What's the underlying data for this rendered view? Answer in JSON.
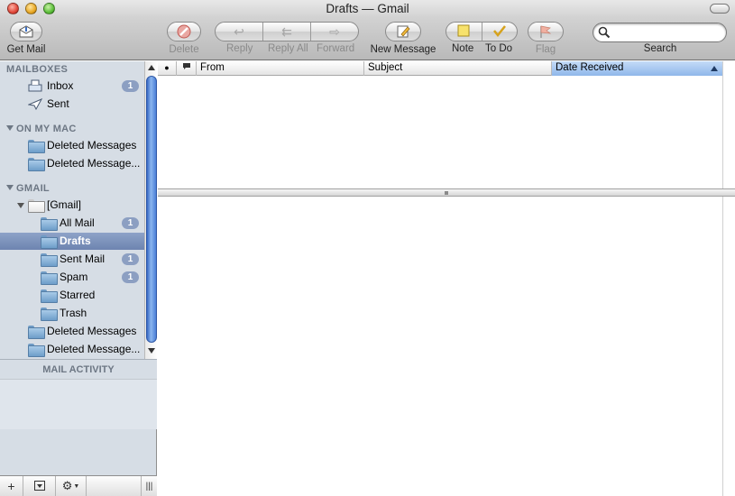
{
  "window": {
    "title": "Drafts — Gmail"
  },
  "toolbar": {
    "get_mail": "Get Mail",
    "delete": "Delete",
    "reply": "Reply",
    "reply_all": "Reply All",
    "forward": "Forward",
    "new_message": "New Message",
    "note": "Note",
    "todo": "To Do",
    "flag": "Flag",
    "search_label": "Search",
    "search_placeholder": ""
  },
  "sidebar": {
    "mailboxes_head": "MAILBOXES",
    "inbox": {
      "label": "Inbox",
      "badge": "1"
    },
    "sent": {
      "label": "Sent"
    },
    "on_my_mac_head": "ON MY MAC",
    "mac_deleted_1": "Deleted Messages",
    "mac_deleted_2": "Deleted Message...",
    "gmail_head": "GMAIL",
    "gmail_folder": "[Gmail]",
    "all_mail": {
      "label": "All Mail",
      "badge": "1"
    },
    "drafts": {
      "label": "Drafts"
    },
    "sent_mail": {
      "label": "Sent Mail",
      "badge": "1"
    },
    "spam": {
      "label": "Spam",
      "badge": "1"
    },
    "starred": {
      "label": "Starred"
    },
    "trash": {
      "label": "Trash"
    },
    "gmail_deleted_1": "Deleted Messages",
    "gmail_deleted_2": "Deleted Message...",
    "activity_head": "MAIL ACTIVITY"
  },
  "message_list": {
    "columns": {
      "from": "From",
      "subject": "Subject",
      "date_received": "Date Received"
    }
  },
  "colors": {
    "selection": "#6d84b0",
    "sorted_column": "#8fb7ea",
    "scroll_thumb": "#3768c4"
  }
}
